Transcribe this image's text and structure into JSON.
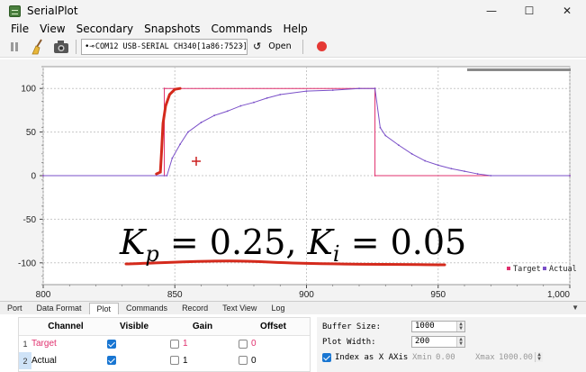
{
  "window": {
    "title": "SerialPlot"
  },
  "menu": [
    "File",
    "View",
    "Secondary",
    "Snapshots",
    "Commands",
    "Help"
  ],
  "toolbar": {
    "port": "COM12 USB-SERIAL CH340[1a86:7523]",
    "open_label": "Open"
  },
  "chart_data": {
    "type": "line",
    "xlim": [
      800,
      1000
    ],
    "ylim": [
      -125,
      125
    ],
    "x_ticks": [
      "800",
      "850",
      "900",
      "950",
      "1,000"
    ],
    "y_ticks": [
      "100",
      "50",
      "0",
      "-50",
      "-100"
    ],
    "grid": true,
    "legend_position": "bottom-right",
    "annotation": "K_p = 0.25, K_i = 0.05",
    "colors": {
      "target": "#e0306e",
      "actual": "#7a4fc8",
      "annotation_marks": "#d42a1c"
    },
    "series": [
      {
        "name": "Target",
        "x": [
          800,
          846,
          846,
          926,
          926,
          1000
        ],
        "y": [
          0,
          0,
          100,
          100,
          0,
          0
        ]
      },
      {
        "name": "Actual",
        "x": [
          800,
          847,
          849,
          852,
          855,
          860,
          865,
          870,
          875,
          880,
          885,
          890,
          900,
          910,
          920,
          926,
          928,
          930,
          935,
          940,
          945,
          950,
          955,
          960,
          965,
          970,
          1000
        ],
        "y": [
          0,
          0,
          20,
          36,
          50,
          61,
          69,
          74,
          80,
          84,
          89,
          93,
          97,
          98,
          100,
          100,
          55,
          46,
          35,
          25,
          17,
          12,
          8,
          5,
          2,
          0,
          0
        ]
      }
    ]
  },
  "tabs": [
    "Port",
    "Data Format",
    "Plot",
    "Commands",
    "Record",
    "Text View",
    "Log"
  ],
  "channels": {
    "headers": [
      "Channel",
      "Visible",
      "Gain",
      "Offset"
    ],
    "rows": [
      {
        "num": "1",
        "name": "Target",
        "gain": "1",
        "offset": "0",
        "color": "#e0306e"
      },
      {
        "num": "2",
        "name": "Actual",
        "gain": "1",
        "offset": "0",
        "color": "#000000"
      }
    ]
  },
  "settings": {
    "buffer_label": "Buffer Size:",
    "buffer_value": "1000",
    "plot_width_label": "Plot Width:",
    "plot_width_value": "200",
    "index_label": "Index as X AXis",
    "xmin_label": "Xmin",
    "xmin_value": "0.00",
    "xmax_label": "Xmax",
    "xmax_value": "1000.00"
  }
}
